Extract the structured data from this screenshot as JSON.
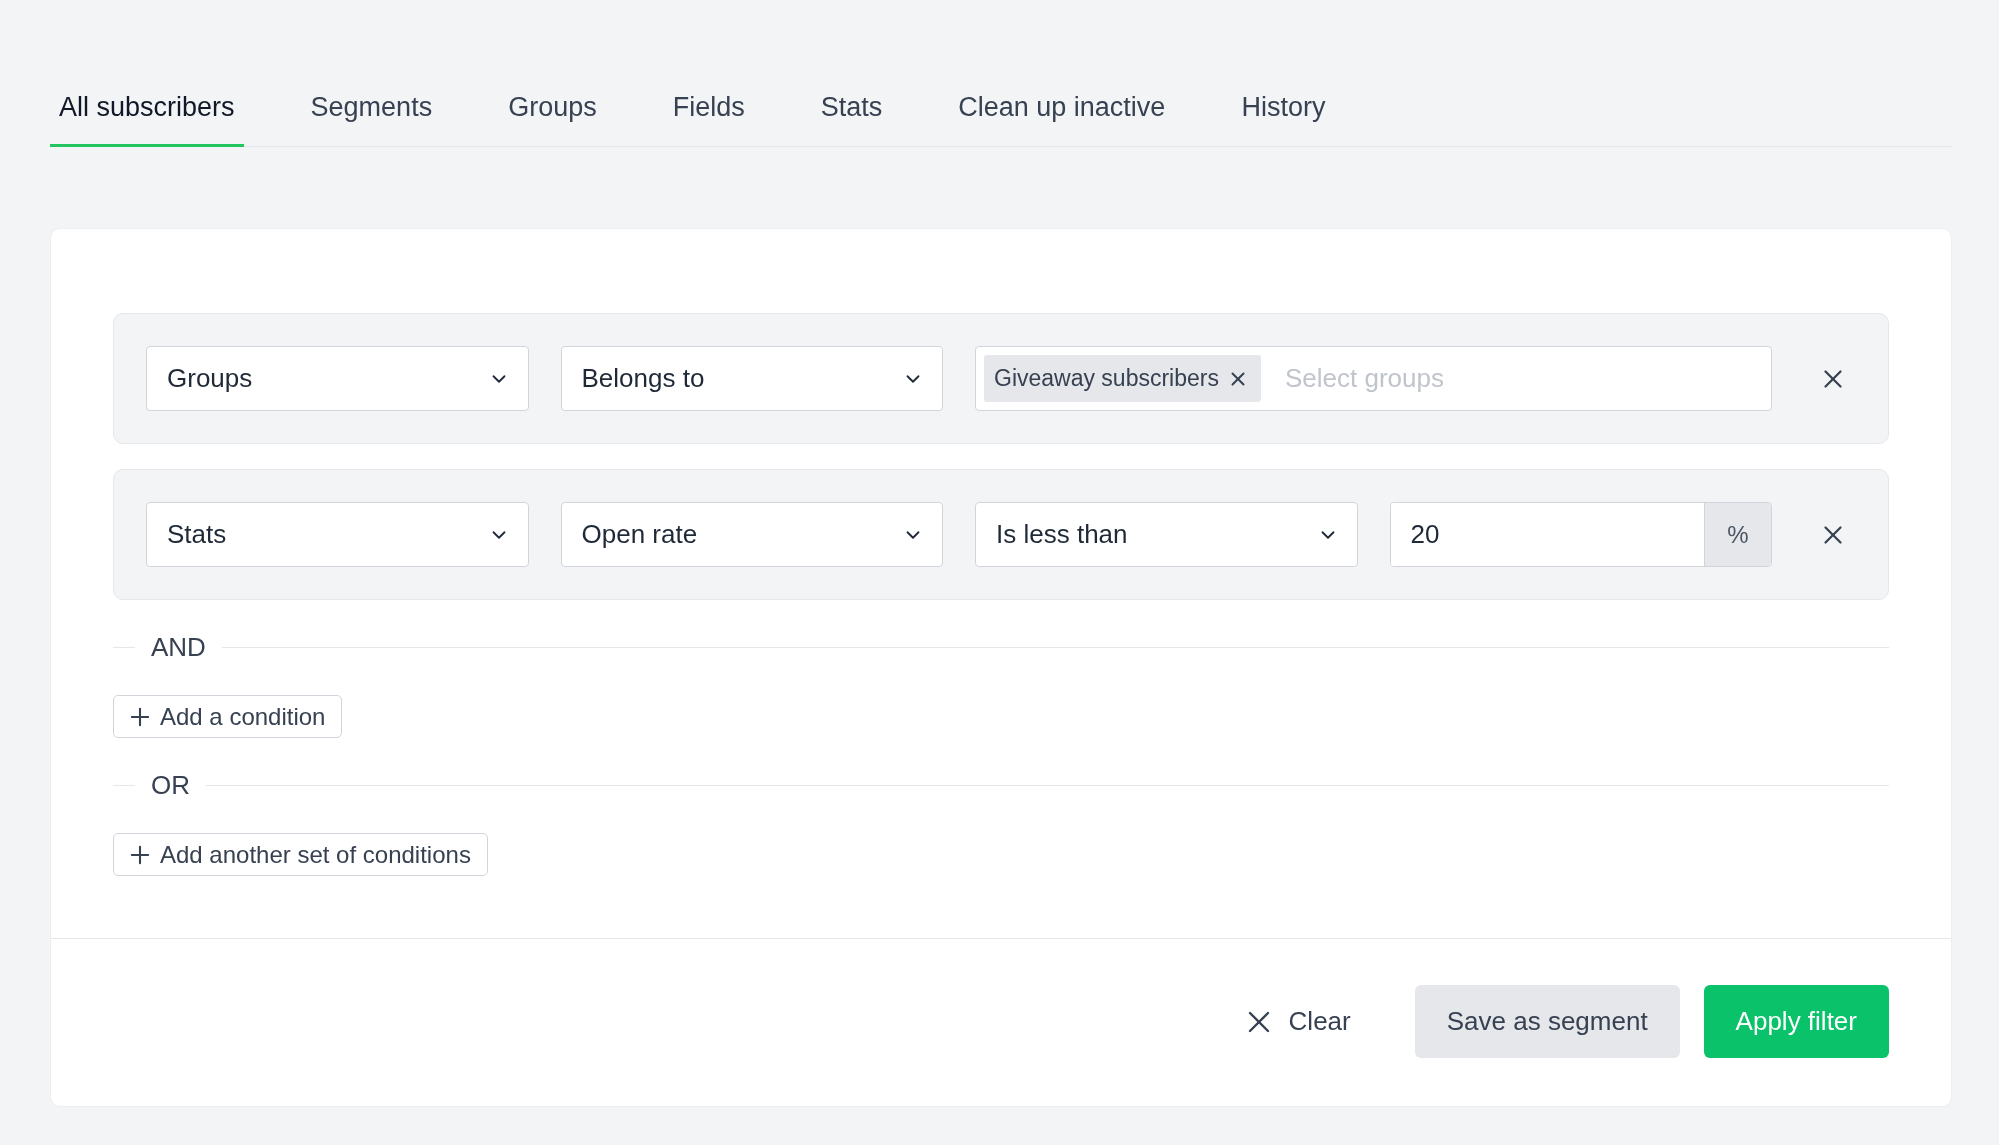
{
  "tabs": [
    {
      "label": "All subscribers",
      "selected": true
    },
    {
      "label": "Segments",
      "selected": false
    },
    {
      "label": "Groups",
      "selected": false
    },
    {
      "label": "Fields",
      "selected": false
    },
    {
      "label": "Stats",
      "selected": false
    },
    {
      "label": "Clean up inactive",
      "selected": false
    },
    {
      "label": "History",
      "selected": false
    }
  ],
  "condition_rows": [
    {
      "fields": [
        {
          "kind": "select",
          "value": "Groups"
        },
        {
          "kind": "select",
          "value": "Belongs to"
        },
        {
          "kind": "tags",
          "tags": [
            "Giveaway subscribers"
          ],
          "placeholder": "Select groups"
        }
      ]
    },
    {
      "fields": [
        {
          "kind": "select",
          "value": "Stats"
        },
        {
          "kind": "select",
          "value": "Open rate"
        },
        {
          "kind": "select",
          "value": "Is less than"
        },
        {
          "kind": "number",
          "value": "20",
          "unit": "%"
        }
      ]
    }
  ],
  "and_label": "AND",
  "add_condition_button": "Add a condition",
  "or_label": "OR",
  "add_set_button": "Add another set of conditions",
  "footer_buttons": [
    {
      "kind": "link",
      "label": "Clear"
    },
    {
      "kind": "secondary",
      "label": "Save as segment"
    },
    {
      "kind": "primary",
      "label": "Apply filter"
    }
  ]
}
